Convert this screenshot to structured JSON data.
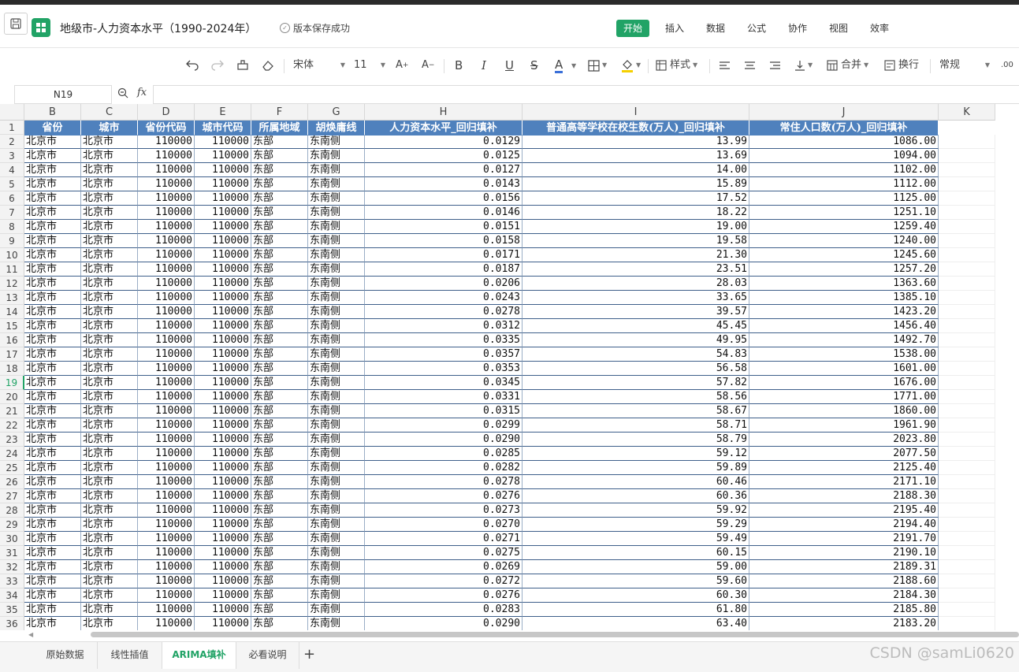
{
  "titlebar": {
    "doc_title": "地级市-人力资本水平（1990-2024年）",
    "save_status": "版本保存成功",
    "menus": [
      "开始",
      "插入",
      "数据",
      "公式",
      "协作",
      "视图",
      "效率"
    ]
  },
  "toolbar": {
    "font_name": "宋体",
    "font_size": "11",
    "bold": "B",
    "italic": "I",
    "underline": "U",
    "strike": "S",
    "font_color": "A",
    "style_label": "样式",
    "merge_label": "合并",
    "wrap_label": "换行",
    "number_format": "常规",
    "decimal": ".00"
  },
  "formula_bar": {
    "cell_ref": "N19",
    "fx": "fx",
    "value": ""
  },
  "grid": {
    "columns": [
      "B",
      "C",
      "D",
      "E",
      "F",
      "G",
      "H",
      "I",
      "J",
      "K"
    ],
    "header_row": [
      "省份",
      "城市",
      "省份代码",
      "城市代码",
      "所属地域",
      "胡焕庸线",
      "人力资本水平_回归填补",
      "普通高等学校在校生数(万人)_回归填补",
      "常住人口数(万人)_回归填补"
    ],
    "row_numbers": [
      "1",
      "2",
      "3",
      "4",
      "5",
      "6",
      "7",
      "8",
      "9",
      "10",
      "11",
      "12",
      "13",
      "14",
      "15",
      "16",
      "17",
      "18",
      "19",
      "20",
      "21",
      "22",
      "23",
      "24",
      "25",
      "26",
      "27",
      "28",
      "29",
      "30",
      "31",
      "32",
      "33",
      "34",
      "35",
      "36"
    ],
    "selected_row": "19",
    "rows": [
      [
        "北京市",
        "北京市",
        "110000",
        "110000",
        "东部",
        "东南侧",
        "0.0129",
        "13.99",
        "1086.00"
      ],
      [
        "北京市",
        "北京市",
        "110000",
        "110000",
        "东部",
        "东南侧",
        "0.0125",
        "13.69",
        "1094.00"
      ],
      [
        "北京市",
        "北京市",
        "110000",
        "110000",
        "东部",
        "东南侧",
        "0.0127",
        "14.00",
        "1102.00"
      ],
      [
        "北京市",
        "北京市",
        "110000",
        "110000",
        "东部",
        "东南侧",
        "0.0143",
        "15.89",
        "1112.00"
      ],
      [
        "北京市",
        "北京市",
        "110000",
        "110000",
        "东部",
        "东南侧",
        "0.0156",
        "17.52",
        "1125.00"
      ],
      [
        "北京市",
        "北京市",
        "110000",
        "110000",
        "东部",
        "东南侧",
        "0.0146",
        "18.22",
        "1251.10"
      ],
      [
        "北京市",
        "北京市",
        "110000",
        "110000",
        "东部",
        "东南侧",
        "0.0151",
        "19.00",
        "1259.40"
      ],
      [
        "北京市",
        "北京市",
        "110000",
        "110000",
        "东部",
        "东南侧",
        "0.0158",
        "19.58",
        "1240.00"
      ],
      [
        "北京市",
        "北京市",
        "110000",
        "110000",
        "东部",
        "东南侧",
        "0.0171",
        "21.30",
        "1245.60"
      ],
      [
        "北京市",
        "北京市",
        "110000",
        "110000",
        "东部",
        "东南侧",
        "0.0187",
        "23.51",
        "1257.20"
      ],
      [
        "北京市",
        "北京市",
        "110000",
        "110000",
        "东部",
        "东南侧",
        "0.0206",
        "28.03",
        "1363.60"
      ],
      [
        "北京市",
        "北京市",
        "110000",
        "110000",
        "东部",
        "东南侧",
        "0.0243",
        "33.65",
        "1385.10"
      ],
      [
        "北京市",
        "北京市",
        "110000",
        "110000",
        "东部",
        "东南侧",
        "0.0278",
        "39.57",
        "1423.20"
      ],
      [
        "北京市",
        "北京市",
        "110000",
        "110000",
        "东部",
        "东南侧",
        "0.0312",
        "45.45",
        "1456.40"
      ],
      [
        "北京市",
        "北京市",
        "110000",
        "110000",
        "东部",
        "东南侧",
        "0.0335",
        "49.95",
        "1492.70"
      ],
      [
        "北京市",
        "北京市",
        "110000",
        "110000",
        "东部",
        "东南侧",
        "0.0357",
        "54.83",
        "1538.00"
      ],
      [
        "北京市",
        "北京市",
        "110000",
        "110000",
        "东部",
        "东南侧",
        "0.0353",
        "56.58",
        "1601.00"
      ],
      [
        "北京市",
        "北京市",
        "110000",
        "110000",
        "东部",
        "东南侧",
        "0.0345",
        "57.82",
        "1676.00"
      ],
      [
        "北京市",
        "北京市",
        "110000",
        "110000",
        "东部",
        "东南侧",
        "0.0331",
        "58.56",
        "1771.00"
      ],
      [
        "北京市",
        "北京市",
        "110000",
        "110000",
        "东部",
        "东南侧",
        "0.0315",
        "58.67",
        "1860.00"
      ],
      [
        "北京市",
        "北京市",
        "110000",
        "110000",
        "东部",
        "东南侧",
        "0.0299",
        "58.71",
        "1961.90"
      ],
      [
        "北京市",
        "北京市",
        "110000",
        "110000",
        "东部",
        "东南侧",
        "0.0290",
        "58.79",
        "2023.80"
      ],
      [
        "北京市",
        "北京市",
        "110000",
        "110000",
        "东部",
        "东南侧",
        "0.0285",
        "59.12",
        "2077.50"
      ],
      [
        "北京市",
        "北京市",
        "110000",
        "110000",
        "东部",
        "东南侧",
        "0.0282",
        "59.89",
        "2125.40"
      ],
      [
        "北京市",
        "北京市",
        "110000",
        "110000",
        "东部",
        "东南侧",
        "0.0278",
        "60.46",
        "2171.10"
      ],
      [
        "北京市",
        "北京市",
        "110000",
        "110000",
        "东部",
        "东南侧",
        "0.0276",
        "60.36",
        "2188.30"
      ],
      [
        "北京市",
        "北京市",
        "110000",
        "110000",
        "东部",
        "东南侧",
        "0.0273",
        "59.92",
        "2195.40"
      ],
      [
        "北京市",
        "北京市",
        "110000",
        "110000",
        "东部",
        "东南侧",
        "0.0270",
        "59.29",
        "2194.40"
      ],
      [
        "北京市",
        "北京市",
        "110000",
        "110000",
        "东部",
        "东南侧",
        "0.0271",
        "59.49",
        "2191.70"
      ],
      [
        "北京市",
        "北京市",
        "110000",
        "110000",
        "东部",
        "东南侧",
        "0.0275",
        "60.15",
        "2190.10"
      ],
      [
        "北京市",
        "北京市",
        "110000",
        "110000",
        "东部",
        "东南侧",
        "0.0269",
        "59.00",
        "2189.31"
      ],
      [
        "北京市",
        "北京市",
        "110000",
        "110000",
        "东部",
        "东南侧",
        "0.0272",
        "59.60",
        "2188.60"
      ],
      [
        "北京市",
        "北京市",
        "110000",
        "110000",
        "东部",
        "东南侧",
        "0.0276",
        "60.30",
        "2184.30"
      ],
      [
        "北京市",
        "北京市",
        "110000",
        "110000",
        "东部",
        "东南侧",
        "0.0283",
        "61.80",
        "2185.80"
      ],
      [
        "北京市",
        "北京市",
        "110000",
        "110000",
        "东部",
        "东南侧",
        "0.0290",
        "63.40",
        "2183.20"
      ]
    ]
  },
  "sheet_tabs": [
    "原始数据",
    "线性插值",
    "ARIMA填补",
    "必看说明"
  ],
  "active_tab": "ARIMA填补",
  "add_tab": "+",
  "watermark": "CSDN @samLi0620",
  "colors": {
    "accent": "#21a366",
    "header_fill": "#4f81bd",
    "header_text": "#ffffff"
  }
}
